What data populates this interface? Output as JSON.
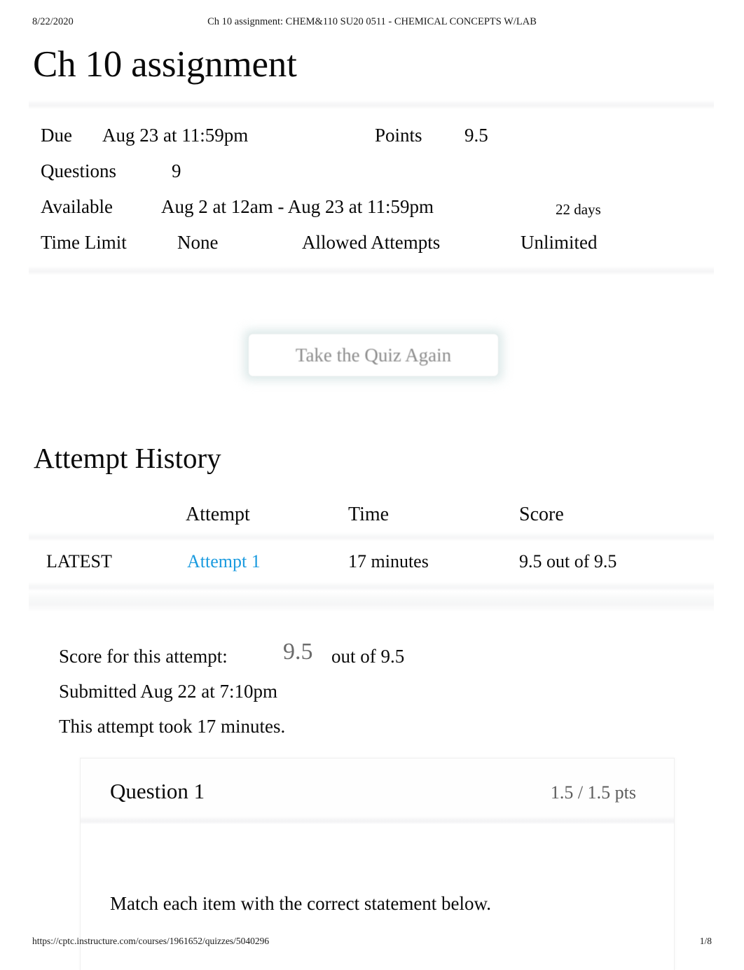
{
  "print_header": {
    "date": "8/22/2020",
    "title": "Ch 10 assignment: CHEM&110 SU20 0511 - CHEMICAL CONCEPTS W/LAB"
  },
  "page": {
    "title": "Ch 10 assignment"
  },
  "quiz_details": {
    "due_label": "Due",
    "due_value": "Aug 23 at 11:59pm",
    "points_label": "Points",
    "points_value": "9.5",
    "questions_label": "Questions",
    "questions_value": "9",
    "available_label": "Available",
    "available_value": "Aug 2 at 12am - Aug 23 at 11:59pm",
    "available_duration": "22 days",
    "time_limit_label": "Time Limit",
    "time_limit_value": "None",
    "allowed_attempts_label": "Allowed Attempts",
    "allowed_attempts_value": "Unlimited"
  },
  "actions": {
    "take_quiz_again": "Take the Quiz Again"
  },
  "attempt_history": {
    "heading": "Attempt History",
    "columns": [
      "",
      "Attempt",
      "Time",
      "Score"
    ],
    "rows": [
      {
        "kept": "LATEST",
        "attempt": "Attempt 1",
        "time": "17 minutes",
        "score": "9.5 out of 9.5"
      }
    ]
  },
  "score_summary": {
    "score_label": "Score for this attempt:",
    "score_value": "9.5",
    "score_out_of": "out of 9.5",
    "submitted": "Submitted Aug 22 at 7:10pm",
    "duration": "This attempt took 17 minutes."
  },
  "question": {
    "title": "Question 1",
    "points": "1.5 / 1.5 pts",
    "text": "Match each item with the correct statement below."
  },
  "print_footer": {
    "url": "https://cptc.instructure.com/courses/1961652/quizzes/5040296",
    "page": "1/8"
  },
  "colors": {
    "link": "#1b9bdf",
    "muted_text": "#5c5c5c",
    "button_text": "#8c8c8c",
    "rule": "#f5f5f6",
    "link_highlight": "#e1f1f7"
  }
}
